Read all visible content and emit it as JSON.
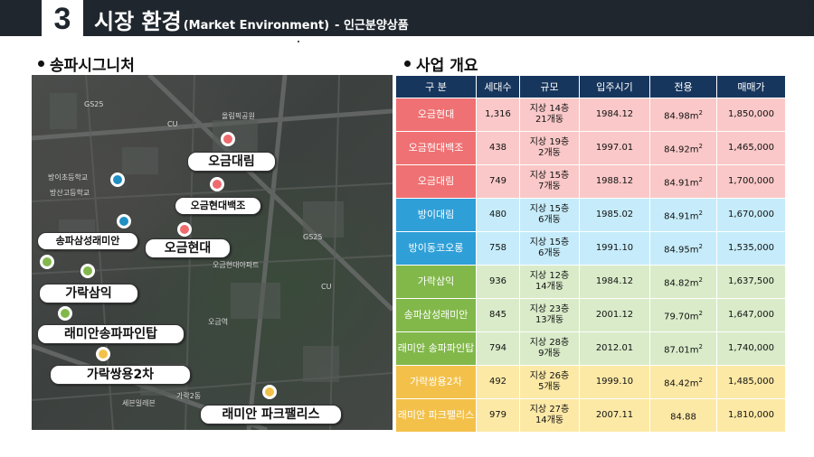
{
  "header": {
    "number": "3",
    "title": "시장 환경",
    "subtitle": "(Market Environment)",
    "tail": "- 인근분양상품"
  },
  "sections": {
    "map_title": "송파시그니처",
    "table_title": "사업 개요"
  },
  "map": {
    "labels": [
      {
        "id": "ogeum-daerim",
        "text": "오금대림",
        "pin_color": "#ef6b6e"
      },
      {
        "id": "ogeum-hyundai-baekjo",
        "text": "오금현대백조",
        "pin_color": "#ef6b6e"
      },
      {
        "id": "ogeum-hyundai",
        "text": "오금현대",
        "pin_color": "#ef6b6e"
      },
      {
        "id": "songpa-samsung-raemian",
        "text": "송파삼성래미안",
        "pin_color": "#82b84a"
      },
      {
        "id": "garak-samik",
        "text": "가락삼익",
        "pin_color": "#82b84a"
      },
      {
        "id": "raemian-songpa-paintap",
        "text": "래미안송파파인탑",
        "pin_color": "#82b84a"
      },
      {
        "id": "garak-ssangyong",
        "text": "가락쌍용2차",
        "pin_color": "#f3c14a"
      },
      {
        "id": "raemian-park-palace",
        "text": "래미안 파크팰리스",
        "pin_color": "#f3c14a"
      }
    ],
    "blue_pin_color": "#1f8fc4",
    "places": [
      "GS25",
      "CU",
      "방이초등학교",
      "오금현대아파트",
      "가락2동",
      "세븐일레븐",
      "올림픽공원",
      "방산고등학교",
      "오금역",
      "GS25",
      "CU",
      "가락시장"
    ]
  },
  "table": {
    "headers": [
      "구 분",
      "세대수",
      "규모",
      "입주시기",
      "전용",
      "매매가"
    ],
    "rows": [
      {
        "group": "red",
        "name": "오금현대",
        "units": "1,316",
        "scale": [
          "지상 14층",
          "21개동"
        ],
        "date": "1984.12",
        "area": "84.98m",
        "area_sup": "2",
        "price": "1,850,000"
      },
      {
        "group": "red",
        "name": "오금현대백조",
        "units": "438",
        "scale": [
          "지상 19층",
          "2개동"
        ],
        "date": "1997.01",
        "area": "84.92m",
        "area_sup": "2",
        "price": "1,465,000"
      },
      {
        "group": "red",
        "name": "오금대림",
        "units": "749",
        "scale": [
          "지상 15층",
          "7개동"
        ],
        "date": "1988.12",
        "area": "84.91m",
        "area_sup": "2",
        "price": "1,700,000"
      },
      {
        "group": "blue",
        "name": "방이대림",
        "units": "480",
        "scale": [
          "지상 15층",
          "6개동"
        ],
        "date": "1985.02",
        "area": "84.91m",
        "area_sup": "2",
        "price": "1,670,000"
      },
      {
        "group": "blue",
        "name": "방이동코오롱",
        "units": "758",
        "scale": [
          "지상 15층",
          "6개동"
        ],
        "date": "1991.10",
        "area": "84.95m",
        "area_sup": "2",
        "price": "1,535,000"
      },
      {
        "group": "green",
        "name": "가락삼익",
        "units": "936",
        "scale": [
          "지상 12층",
          "14개동"
        ],
        "date": "1984.12",
        "area": "84.82m",
        "area_sup": "2",
        "price": "1,637,500"
      },
      {
        "group": "green",
        "name": "송파삼성래미안",
        "units": "845",
        "scale": [
          "지상 23층",
          "13개동"
        ],
        "date": "2001.12",
        "area": "79.70m",
        "area_sup": "2",
        "price": "1,647,000"
      },
      {
        "group": "green",
        "name": "래미안 송파파인탑",
        "units": "794",
        "scale": [
          "지상 28층",
          "9개동"
        ],
        "date": "2012.01",
        "area": "87.01m",
        "area_sup": "2",
        "price": "1,740,000"
      },
      {
        "group": "yellow",
        "name": "가락쌍용2차",
        "units": "492",
        "scale": [
          "지상 26층",
          "5개동"
        ],
        "date": "1999.10",
        "area": "84.42m",
        "area_sup": "2",
        "price": "1,485,000"
      },
      {
        "group": "yellow",
        "name": "래미안 파크팰리스",
        "units": "979",
        "scale": [
          "지상 27층",
          "14개동"
        ],
        "date": "2007.11",
        "area": "84.88",
        "area_sup": "",
        "price": "1,810,000"
      }
    ]
  }
}
